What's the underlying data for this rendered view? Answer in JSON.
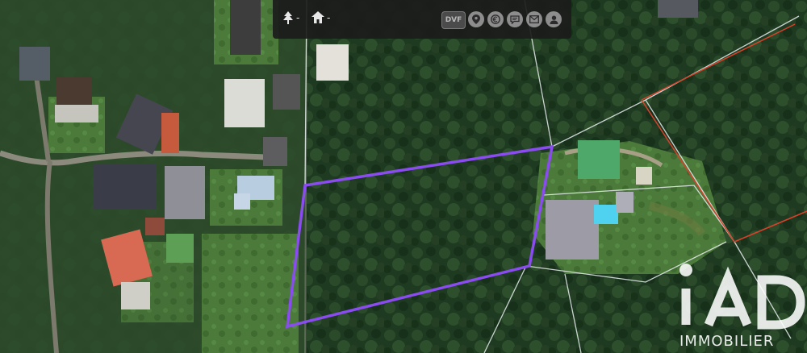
{
  "map": {
    "view": "satellite",
    "highlighted_parcel_color": "#8a4cf0",
    "cadastre_line_color": "#e9eef0",
    "boundary_line_color": "#d9412b"
  },
  "toolbar": {
    "filters": [
      {
        "icon": "tree-icon",
        "value": "-"
      },
      {
        "icon": "house-icon",
        "value": "-"
      }
    ],
    "dvf_label": "DVF",
    "buttons": [
      {
        "icon": "location-pin-icon"
      },
      {
        "icon": "euro-icon"
      },
      {
        "icon": "chat-icon"
      },
      {
        "icon": "mail-icon"
      },
      {
        "icon": "user-icon"
      }
    ]
  },
  "watermark": {
    "brand_text": "iAD",
    "subtitle": "IMMOBILIER"
  }
}
